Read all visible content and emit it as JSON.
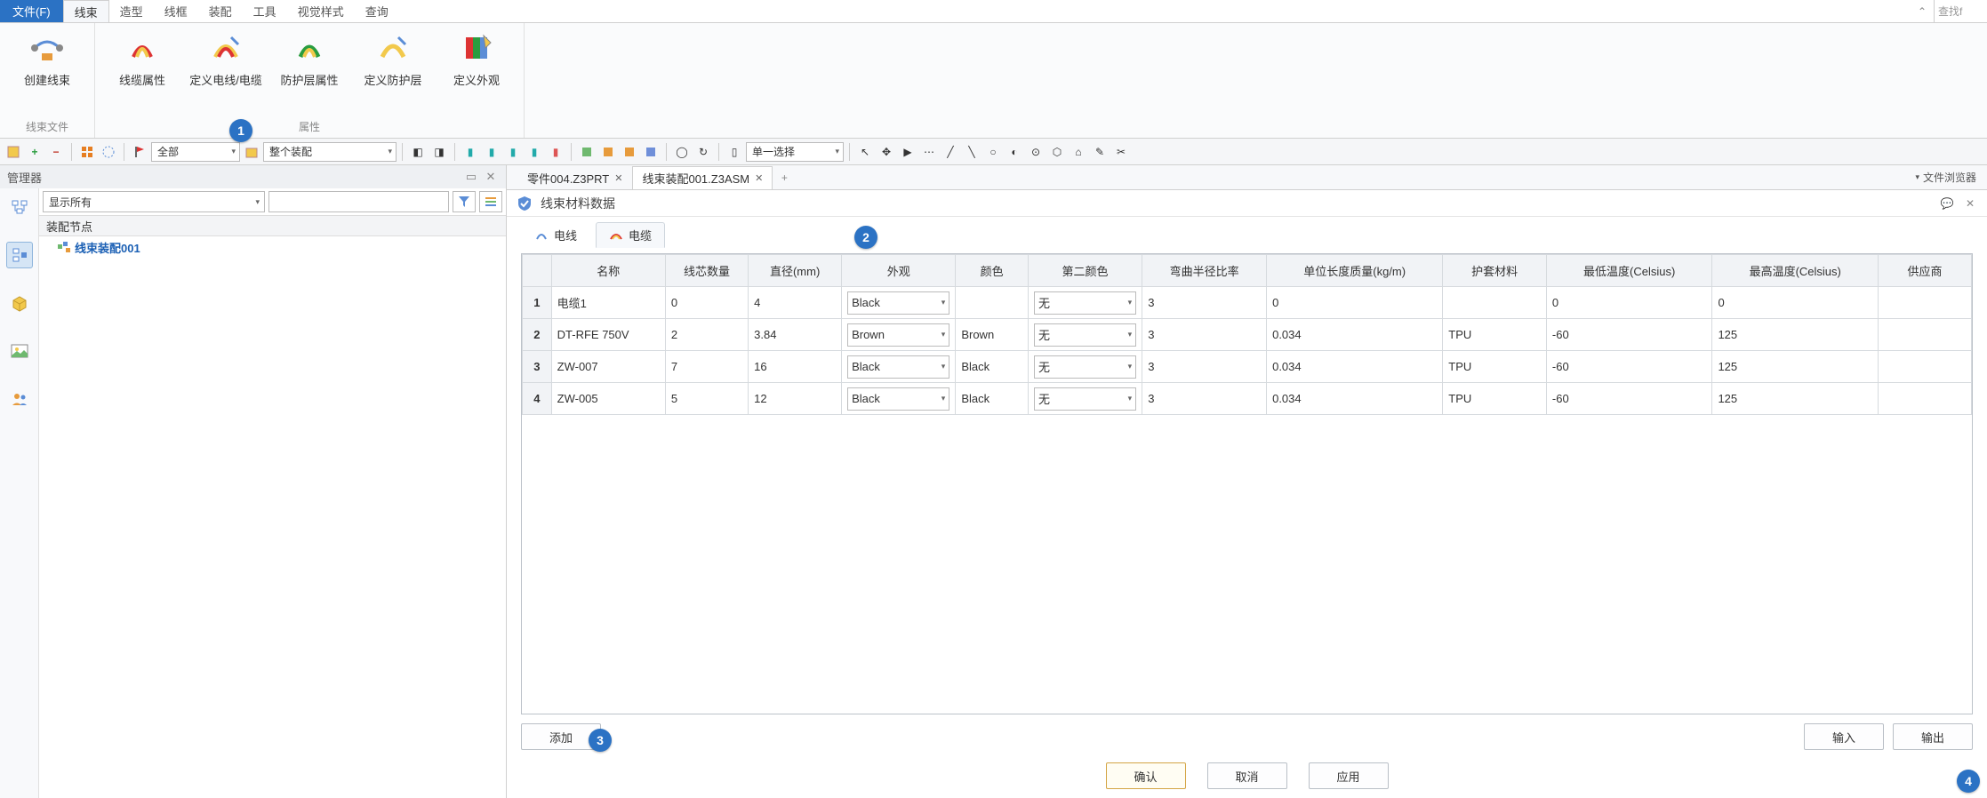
{
  "menu": {
    "file": "文件(F)",
    "tabs": [
      "线束",
      "造型",
      "线框",
      "装配",
      "工具",
      "视觉样式",
      "查询"
    ],
    "active": 0,
    "search_placeholder": "查找f"
  },
  "ribbon": {
    "groups": [
      {
        "label": "线束文件",
        "items": [
          {
            "label": "创建线束",
            "icon": "create-harness-icon"
          }
        ]
      },
      {
        "label": "属性",
        "items": [
          {
            "label": "线缆属性",
            "icon": "cable-prop-icon"
          },
          {
            "label": "定义电线/电缆",
            "icon": "define-wire-icon"
          },
          {
            "label": "防护层属性",
            "icon": "shield-prop-icon"
          },
          {
            "label": "定义防护层",
            "icon": "define-shield-icon"
          },
          {
            "label": "定义外观",
            "icon": "define-appear-icon"
          }
        ]
      }
    ]
  },
  "toolbar": {
    "combo1": "全部",
    "combo2": "整个装配",
    "combo3": "单一选择"
  },
  "manager": {
    "title": "管理器",
    "filter": "显示所有",
    "header": "装配节点",
    "root": "线束装配001"
  },
  "doc_tabs": {
    "items": [
      {
        "label": "零件004.Z3PRT",
        "active": false
      },
      {
        "label": "线束装配001.Z3ASM",
        "active": true
      }
    ],
    "file_browser": "文件浏览器"
  },
  "panel": {
    "title": "线束材料数据",
    "tabs": [
      {
        "label": "电线",
        "active": false,
        "icon": "wire-icon"
      },
      {
        "label": "电缆",
        "active": true,
        "icon": "cable-icon"
      }
    ]
  },
  "table": {
    "columns": [
      "",
      "名称",
      "线芯数量",
      "直径(mm)",
      "外观",
      "颜色",
      "第二颜色",
      "弯曲半径比率",
      "单位长度质量(kg/m)",
      "护套材料",
      "最低温度(Celsius)",
      "最高温度(Celsius)",
      "供应商"
    ],
    "rows": [
      {
        "n": "1",
        "name": "电缆1",
        "cores": "0",
        "dia": "4",
        "appear": "Black",
        "color": "",
        "color2": "无",
        "bend": "3",
        "mass": "0",
        "mat": "",
        "tmin": "0",
        "tmax": "0",
        "vendor": ""
      },
      {
        "n": "2",
        "name": "DT-RFE 750V",
        "cores": "2",
        "dia": "3.84",
        "appear": "Brown",
        "color": "Brown",
        "color2": "无",
        "bend": "3",
        "mass": "0.034",
        "mat": "TPU",
        "tmin": "-60",
        "tmax": "125",
        "vendor": ""
      },
      {
        "n": "3",
        "name": "ZW-007",
        "cores": "7",
        "dia": "16",
        "appear": "Black",
        "color": "Black",
        "color2": "无",
        "bend": "3",
        "mass": "0.034",
        "mat": "TPU",
        "tmin": "-60",
        "tmax": "125",
        "vendor": ""
      },
      {
        "n": "4",
        "name": "ZW-005",
        "cores": "5",
        "dia": "12",
        "appear": "Black",
        "color": "Black",
        "color2": "无",
        "bend": "3",
        "mass": "0.034",
        "mat": "TPU",
        "tmin": "-60",
        "tmax": "125",
        "vendor": ""
      }
    ]
  },
  "buttons": {
    "add": "添加",
    "import": "输入",
    "export": "输出",
    "ok": "确认",
    "cancel": "取消",
    "apply": "应用"
  },
  "callouts": [
    "1",
    "2",
    "3",
    "4"
  ]
}
